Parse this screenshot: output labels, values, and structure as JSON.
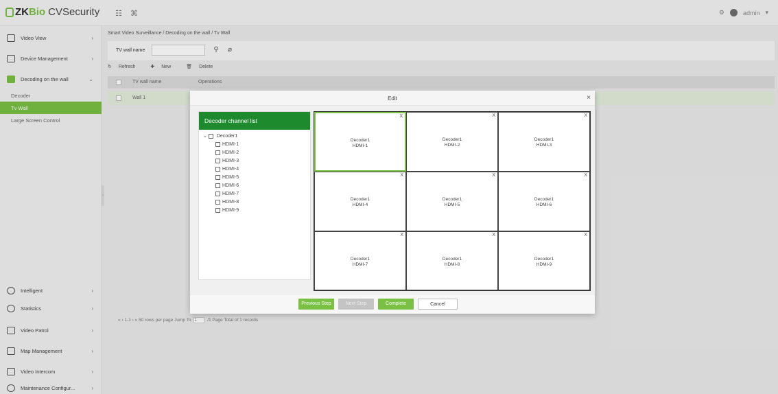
{
  "app": {
    "brand_zk": "ZK",
    "brand_bio": "Bio",
    "brand_cv": "CVSecurity",
    "user": "admin"
  },
  "topbar": {
    "grid_icon": "apps-icon",
    "tools_icon": "tools-icon"
  },
  "sidebar": {
    "items": [
      {
        "label": "Video View",
        "icon": "video-icon"
      },
      {
        "label": "Device Management",
        "icon": "device-icon"
      },
      {
        "label": "Decoding on the wall",
        "icon": "decode-icon"
      },
      {
        "label": "Intelligent",
        "icon": "intelligent-icon"
      },
      {
        "label": "Statistics",
        "icon": "statistics-icon"
      },
      {
        "label": "Video Patrol",
        "icon": "patrol-icon"
      },
      {
        "label": "Map Management",
        "icon": "map-icon"
      },
      {
        "label": "Video Intercom",
        "icon": "intercom-icon"
      },
      {
        "label": "Maintenance Configur...",
        "icon": "maintenance-icon"
      }
    ],
    "sub_items": [
      "Decoder",
      "Tv Wall",
      "Large Screen Control"
    ]
  },
  "main": {
    "breadcrumb": "Smart Video Surveillance / Decoding on the wall / Tv Wall",
    "search_label": "TV wall name",
    "toolbar": {
      "refresh": "Refresh",
      "new": "New",
      "delete": "Delete"
    },
    "columns": [
      "TV wall name",
      "Operations"
    ],
    "rows": [
      {
        "name": "Wall 1"
      }
    ],
    "pager": {
      "range": "1-1",
      "per_page": "50 rows per page",
      "jump_to": "Jump To",
      "page_value": "1",
      "page_total": "/1 Page",
      "total": "Total of 1 records"
    }
  },
  "modal": {
    "title": "Edit",
    "close": "×",
    "channel_list_title": "Decoder channel list",
    "tree_root": "Decoder1",
    "channels": [
      "HDMI-1",
      "HDMI-2",
      "HDMI-3",
      "HDMI-4",
      "HDMI-5",
      "HDMI-6",
      "HDMI-7",
      "HDMI-8",
      "HDMI-9"
    ],
    "cells": [
      {
        "decoder": "Decoder1",
        "channel": "HDMI-1"
      },
      {
        "decoder": "Decoder1",
        "channel": "HDMI-2"
      },
      {
        "decoder": "Decoder1",
        "channel": "HDMI-3"
      },
      {
        "decoder": "Decoder1",
        "channel": "HDMI-4"
      },
      {
        "decoder": "Decoder1",
        "channel": "HDMI-5"
      },
      {
        "decoder": "Decoder1",
        "channel": "HDMI-6"
      },
      {
        "decoder": "Decoder1",
        "channel": "HDMI-7"
      },
      {
        "decoder": "Decoder1",
        "channel": "HDMI-8"
      },
      {
        "decoder": "Decoder1",
        "channel": "HDMI-9"
      }
    ],
    "cell_remove": "X",
    "buttons": {
      "previous": "Previous Step",
      "next": "Next Step",
      "complete": "Complete",
      "cancel": "Cancel"
    }
  },
  "colors": {
    "accent": "#7ac143",
    "channel_header": "#1e8a2e"
  }
}
